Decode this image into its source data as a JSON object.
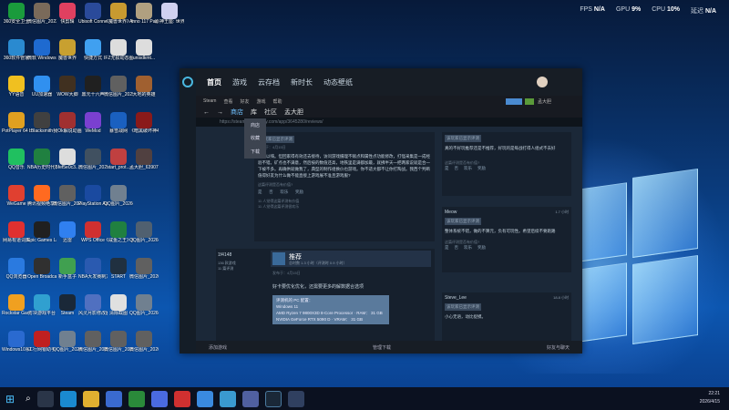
{
  "hud": {
    "fps_label": "FPS",
    "fps": "N/A",
    "gpu_label": "GPU",
    "gpu": "9%",
    "cpu_label": "CPU",
    "cpu": "10%",
    "lat_label": "延迟",
    "lat": "N/A"
  },
  "desktop_icons": [
    {
      "label": "360安全卫士",
      "color": "#1a9b3c"
    },
    {
      "label": "微信图片_2023011...",
      "color": "#7a6a5a"
    },
    {
      "label": "快剪辑",
      "color": "#e04060"
    },
    {
      "label": "Ubisoft Connect",
      "color": "#2a4a9a"
    },
    {
      "label": "《魔兽世界》经典怀旧服",
      "color": "#c89a30"
    },
    {
      "label": "Anno 117 Pax Romana",
      "color": "#b0a080"
    },
    {
      "label": "原神王座: 世界",
      "color": "#d0d0f0"
    },
    {
      "label": "360软件管家",
      "color": "#2a8ad0"
    },
    {
      "label": "微软 Windows...",
      "color": "#1e6ad0"
    },
    {
      "label": "魔兽世界",
      "color": "#c8a030"
    },
    {
      "label": "快捷方式",
      "color": "#40a0f0"
    },
    {
      "label": "IFZ无损动态图标组件",
      "color": "#ddd"
    },
    {
      "label": "unisdkmt...",
      "color": "#ddd"
    },
    {
      "label": "YY语音",
      "color": "#f0c020"
    },
    {
      "label": "UU加速器",
      "color": "#3090f0"
    },
    {
      "label": "WOW大脚",
      "color": "#403020"
    },
    {
      "label": "鼎元十六声",
      "color": "#202020"
    },
    {
      "label": "微信图片_2025032...",
      "color": "#606060"
    },
    {
      "label": "大地的英雄",
      "color": "#a06030"
    },
    {
      "label": "PotPlayer 64 bit",
      "color": "#e0a020"
    },
    {
      "label": "Blacksmith",
      "color": "#404040"
    },
    {
      "label": "我Ok解说动画",
      "color": "#a03030"
    },
    {
      "label": "WeMod",
      "color": "#7a40d0"
    },
    {
      "label": "暴雪战网",
      "color": "#1a60c0"
    },
    {
      "label": "《暗黑破坏神4》",
      "color": "#8a1a1a"
    },
    {
      "label": "QQ音乐",
      "color": "#20c060"
    },
    {
      "label": "NBA历史时代模拟.xls",
      "color": "#208040"
    },
    {
      "label": "5fef5e0c3...",
      "color": "#ddd"
    },
    {
      "label": "微信图片_20250302...",
      "color": "#405060"
    },
    {
      "label": "start_prot...",
      "color": "#c04040"
    },
    {
      "label": "孟大胆_6390774...",
      "color": "#504040"
    },
    {
      "label": "WeGame",
      "color": "#e04030"
    },
    {
      "label": "腾讯视频绝享版",
      "color": "#ff6a20"
    },
    {
      "label": "微信图片_20241001...",
      "color": "#606060"
    },
    {
      "label": "PlayStation Accessories",
      "color": "#1a4aa0"
    },
    {
      "label": "QQ图片_20260301...",
      "color": "#708090"
    },
    {
      "label": "网易有道词典",
      "color": "#e03030"
    },
    {
      "label": "Epic Games Launcher",
      "color": "#202020"
    },
    {
      "label": "迅雷",
      "color": "#3080f0"
    },
    {
      "label": "WPS Office",
      "color": "#d03030"
    },
    {
      "label": "《咸鱼之王》使用方法.xls",
      "color": "#208040"
    },
    {
      "label": "QQ图片_20260312...",
      "color": "#506070"
    },
    {
      "label": "QQ浏览器",
      "color": "#2a7ae0"
    },
    {
      "label": "Open Broadcast...",
      "color": "#303030"
    },
    {
      "label": "新手盒子",
      "color": "#40a050"
    },
    {
      "label": "NBA大发赛制方案.docx",
      "color": "#2a5ab0"
    },
    {
      "label": "START",
      "color": "#203040"
    },
    {
      "label": "微信图片_20260302...",
      "color": "#606060"
    },
    {
      "label": "Rockstar Games...",
      "color": "#f0a020"
    },
    {
      "label": "方块游戏平台",
      "color": "#30a0d0"
    },
    {
      "label": "Steam",
      "color": "#1a2838"
    },
    {
      "label": "风灵月影修改器",
      "color": "#5070c0"
    },
    {
      "label": "清除截图",
      "color": "#e0e0e0"
    },
    {
      "label": "QQ图片_20260320...",
      "color": "#708090"
    },
    {
      "label": "Windows10系统清理工具",
      "color": "#2a6ad0"
    },
    {
      "label": "工行网银助手",
      "color": "#c02020"
    },
    {
      "label": "QQ图片_20240708...",
      "color": "#708090"
    },
    {
      "label": "微信图片_2025032...",
      "color": "#606060"
    },
    {
      "label": "微信图片_20251109...",
      "color": "#606060"
    },
    {
      "label": "微信图片_20260322...",
      "color": "#606060"
    }
  ],
  "steam": {
    "nav": [
      "首页",
      "游戏",
      "云存档",
      "新时长",
      "动态壁纸"
    ],
    "menu": [
      "Steam",
      "查看",
      "好友",
      "游戏",
      "帮助"
    ],
    "subnav": [
      "商店",
      "库",
      "社区",
      "孟大胆"
    ],
    "url": "https://steamcommunity.com/app/3645280/reviews/",
    "dropdown": [
      "商店",
      "收藏",
      "下载"
    ],
    "review1": {
      "header": "该玩家已显示评测",
      "posted": "发布于：4月15日",
      "text": "性问以嗨。但回家得有效还去接待，访问游戏摄理不赋点和属性点功能修改，打怪采集是一成经验不错。矿点也不满意，然后按的数值还高，地铁里是满都加最，就拂半天一把两家说就是合一下被不多。再确供就做我了，典型的制作组换价也游戏。你不适大都不让你打陶战。我西个判断值得好友为什么做不能直接上游戏展不准且游戏服?",
      "helpful": "这篇评测是否有价值?",
      "yes": "是",
      "no": "否",
      "funny": "欢乐",
      "award": "奖励",
      "count1": "11 人觉得这篇评测有价值",
      "count2": "11 人觉得这篇评测很欢乐"
    },
    "review2": {
      "user": "1f4148",
      "games": "136 款游戏",
      "reviews": "11 篇评测",
      "rec": "推荐",
      "hours": "总时数 1.3 小时（评测时 0.9 小时）",
      "posted": "发布于：4月15日",
      "text": "好卡要优化优化，还需要更多的解数据合选项",
      "spec_title": "评测机的 PC 配置：",
      "spec_os": "Windows 11",
      "spec_cpu": "AMD Ryzen 7 9800X3D 8-Core Processor · RAM： 31 GB",
      "spec_gpu": "NVIDIA GeForce RTX 5090 D · VRAM： 31 GB"
    },
    "side1": {
      "header": "该玩家已显示评测",
      "text": "真的不好玩推荐还是不推荐，好玩的是每战打得人组式不去好",
      "helpful": "这篇评测是否有价值?",
      "yes": "是",
      "no": "否",
      "funny": "欢乐",
      "award": "奖励"
    },
    "side2": {
      "user": "Meow",
      "hours": "1.7 小时",
      "header": "该玩家已显示评测",
      "text": "整体系统不错，做的不算元，负有可玩性。希望后续不要跑路",
      "helpful": "这篇评测是否有价值?",
      "yes": "是",
      "no": "否",
      "funny": "欢乐",
      "award": "奖励"
    },
    "side3": {
      "user": "Steve_Lee",
      "hours": "18.8 小时",
      "header": "该玩家已显示评测",
      "text": "小心无语，动比捉摸。"
    },
    "bottom": {
      "add": "添加游戏",
      "manage": "管理下载",
      "friends": "好友与聊天"
    }
  },
  "clock": {
    "time": "22:21",
    "date": "2026/4/15"
  }
}
